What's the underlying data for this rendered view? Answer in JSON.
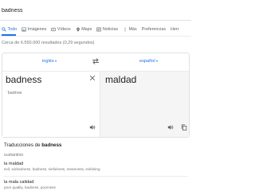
{
  "search": {
    "value": "badness"
  },
  "tabs": [
    {
      "label": "Todo",
      "icon": "search-icon",
      "active": true
    },
    {
      "label": "Imágenes",
      "icon": "image-icon",
      "active": false
    },
    {
      "label": "Vídeos",
      "icon": "video-icon",
      "active": false
    },
    {
      "label": "Maps",
      "icon": "map-pin-icon",
      "active": false
    },
    {
      "label": "Noticias",
      "icon": "news-icon",
      "active": false
    },
    {
      "label": "Más",
      "icon": "more-icon",
      "active": false
    },
    {
      "label": "Preferencias",
      "icon": "",
      "active": false
    },
    {
      "label": "Herr",
      "icon": "",
      "active": false
    }
  ],
  "result_stats": "Cerca de 6.550.000 resultados (0,29 segundos)",
  "translator": {
    "source_lang": "inglés",
    "target_lang": "español",
    "source_text": "badness",
    "transliteration": "ˈbadnəs",
    "target_text": "maldad",
    "accent_color": "#1a73e8"
  },
  "translations": {
    "heading_prefix": "Traducciones de",
    "heading_word": "badness",
    "part_of_speech": "sustantivo",
    "entries": [
      {
        "word": "la maldad",
        "synonyms": "evil, wickedness, badness, sinfulness, meanness, evildoing"
      },
      {
        "word": "la mala calidad",
        "synonyms": "poor quality, badness, poorness"
      }
    ]
  }
}
